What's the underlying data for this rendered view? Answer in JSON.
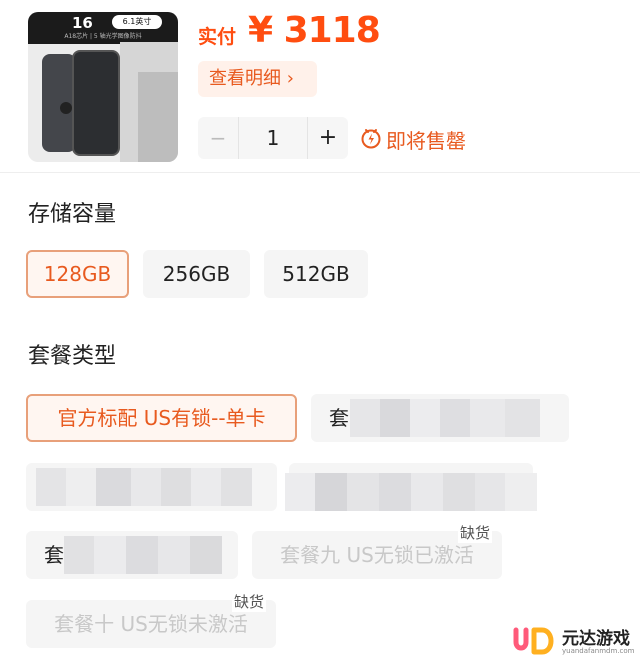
{
  "product": {
    "thumb_title": "16",
    "thumb_size": "6.1英寸",
    "thumb_sub": "A18芯片 | 5 轴光学图像防抖"
  },
  "price": {
    "label": "实付",
    "value": "¥ 3118",
    "detail_label": "查看明细 ›"
  },
  "quantity": {
    "minus": "−",
    "value": "1",
    "plus": "+"
  },
  "sale_status": "即将售罄",
  "storage": {
    "title": "存储容量",
    "options": [
      "128GB",
      "256GB",
      "512GB"
    ],
    "selected": "128GB"
  },
  "package": {
    "title": "套餐类型",
    "options": [
      {
        "label": "官方标配 US有锁--单卡",
        "state": "selected"
      },
      {
        "label": "套",
        "state": "redacted"
      },
      {
        "label": "",
        "state": "redacted"
      },
      {
        "label": "",
        "state": "redacted"
      },
      {
        "label": "套",
        "state": "redacted"
      },
      {
        "label": "套餐九 US无锁已激活",
        "state": "out_of_stock"
      },
      {
        "label": "套餐十 US无锁未激活",
        "state": "out_of_stock"
      }
    ],
    "out_of_stock_tag": "缺货"
  },
  "watermark": {
    "name": "元达游戏",
    "url": "yuandafanmdm.com"
  },
  "colors": {
    "accent": "#ff4d10",
    "accent_text": "#e85a1f",
    "selected_border": "#e8a07a",
    "option_bg": "#f5f5f5"
  },
  "icons": {
    "sale_status": "lightning-clock-icon",
    "watermark": "yd-logo-icon"
  }
}
